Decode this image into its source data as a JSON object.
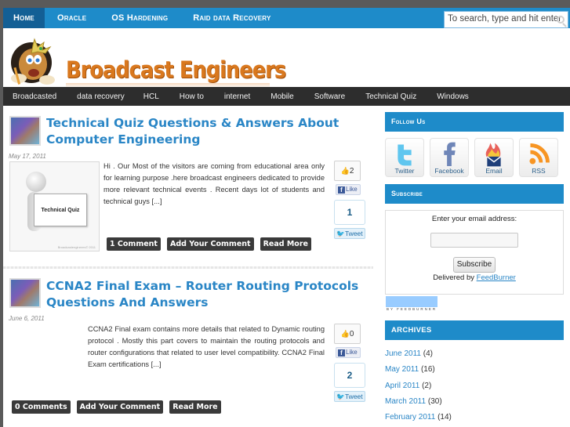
{
  "top_nav": {
    "items": [
      {
        "label": "Home",
        "active": true
      },
      {
        "label": "Oracle",
        "active": false
      },
      {
        "label": "OS Hardening",
        "active": false
      },
      {
        "label": "Raid data Recovery",
        "active": false
      }
    ],
    "search_placeholder": "To search, type and hit enter"
  },
  "logo": {
    "text": "Broadcast Engineers"
  },
  "category_nav": {
    "items": [
      "Broadcasted",
      "data recovery",
      "HCL",
      "How to",
      "internet",
      "Mobile",
      "Software",
      "Technical Quiz",
      "Windows"
    ]
  },
  "posts": [
    {
      "title": "Technical Quiz Questions & Answers About Computer Engineering",
      "date": "May 17, 2011",
      "thumbnail_caption": "Technical Quiz",
      "thumbnail_watermark": "Broadcastengineers© 2011",
      "excerpt": "Hi . Our Most of the visitors are coming from educational area only for learning purpose .here broadcast engineers dedicated to provide more relevant technical events . Recent days lot of students and technical guys [...]",
      "like_count": "2",
      "like_label": "Like",
      "tweet_count": "1",
      "tweet_label": "Tweet",
      "buttons": [
        "1 Comment",
        "Add Your Comment",
        "Read More"
      ]
    },
    {
      "title": "CCNA2 Final Exam – Router Routing Protocols Questions And Answers",
      "date": "June 6, 2011",
      "excerpt": "CCNA2 Final exam contains more details that related to Dynamic routing protocol . Mostly this part covers to maintain the routing protocols and router configurations that related to user level compatibility. CCNA2 Final Exam certifications [...]",
      "like_count": "0",
      "like_label": "Like",
      "tweet_count": "2",
      "tweet_label": "Tweet",
      "buttons": [
        "0 Comments",
        "Add Your Comment",
        "Read More"
      ]
    }
  ],
  "sidebar": {
    "follow": {
      "title": "Follow Us",
      "items": [
        {
          "label": "Twitter",
          "icon": "twitter-icon"
        },
        {
          "label": "Facebook",
          "icon": "facebook-icon"
        },
        {
          "label": "Email",
          "icon": "email-icon"
        },
        {
          "label": "RSS",
          "icon": "rss-icon"
        }
      ]
    },
    "subscribe": {
      "title": "Subscribe",
      "prompt": "Enter your email address:",
      "email_value": "",
      "button_label": "Subscribe",
      "delivered_by": "Delivered by",
      "delivered_link": "FeedBurner",
      "badge_text": "BY FEEDBURNER"
    },
    "archives": {
      "title": "ARCHIVES",
      "items": [
        {
          "label": "June 2011",
          "count": "(4)"
        },
        {
          "label": "May 2011",
          "count": "(16)"
        },
        {
          "label": "April 2011",
          "count": "(2)"
        },
        {
          "label": "March 2011",
          "count": "(30)"
        },
        {
          "label": "February 2011",
          "count": "(14)"
        }
      ]
    }
  },
  "colors": {
    "nav_blue": "#1e8bc9",
    "nav_active": "#135f95",
    "cat_nav_bg": "#2d2d2d",
    "title_blue": "#2a86c6",
    "logo_orange": "#d9781e"
  }
}
